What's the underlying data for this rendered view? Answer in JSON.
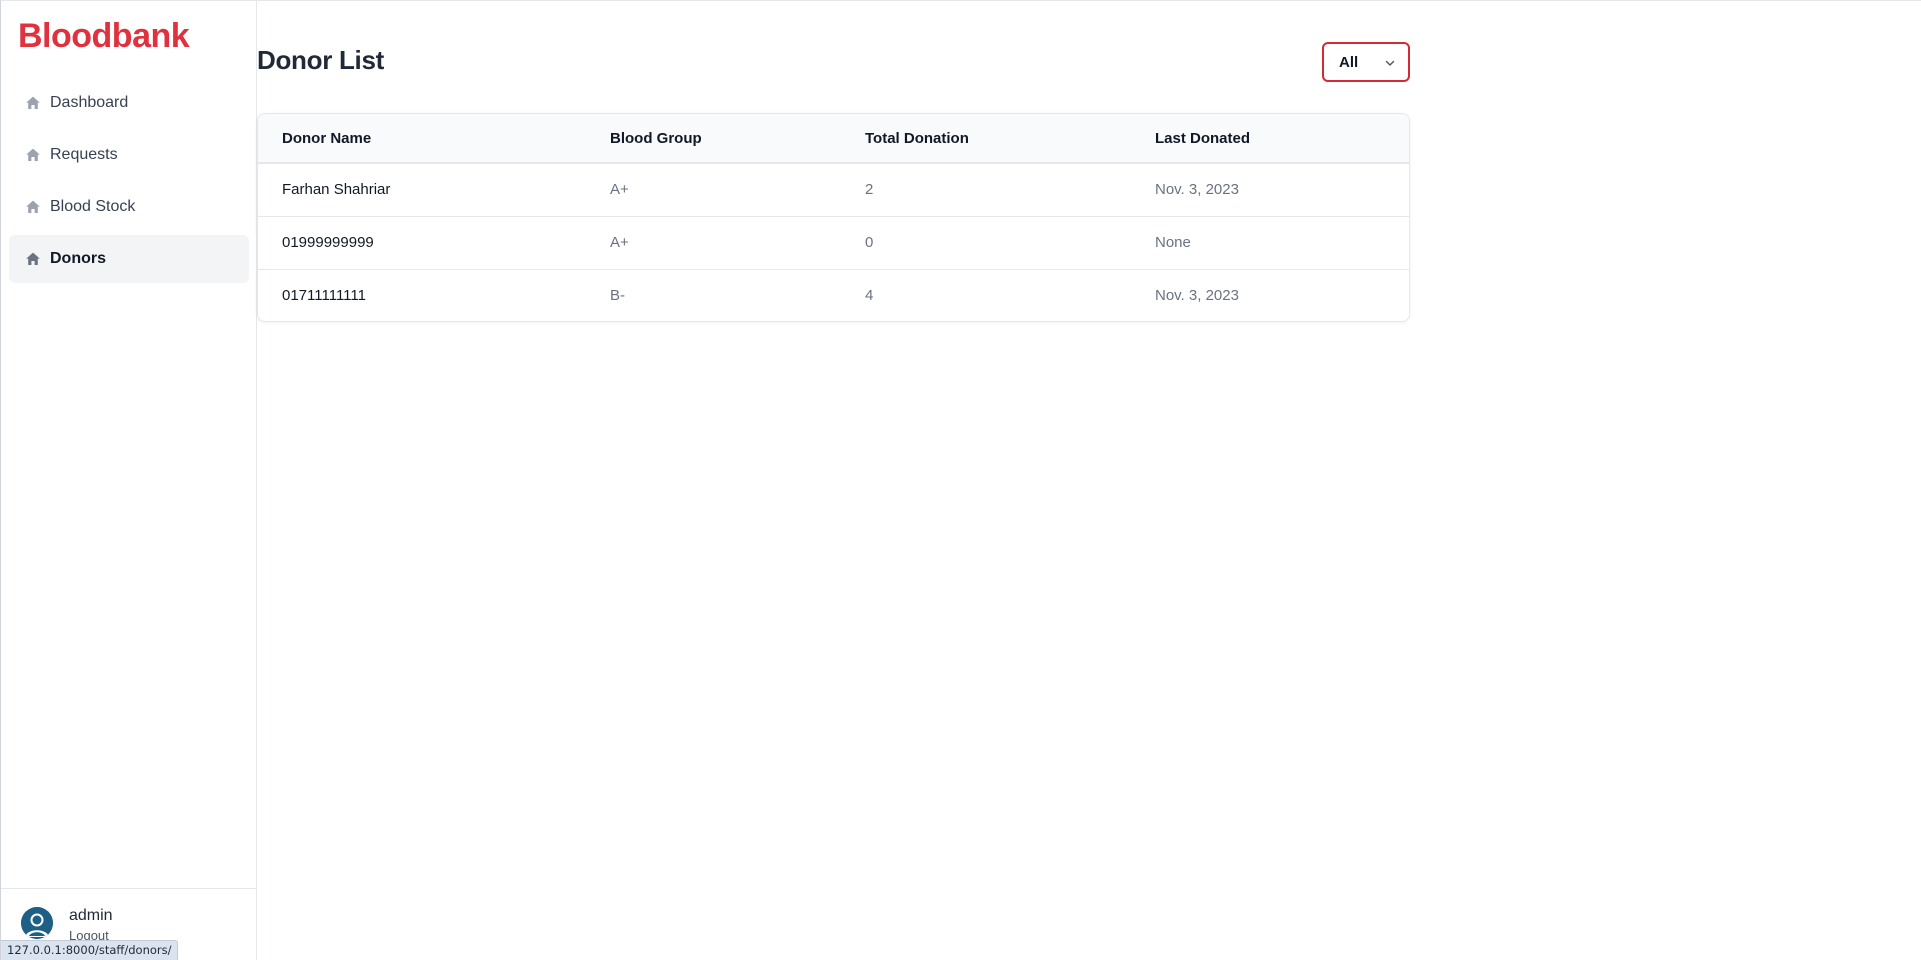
{
  "sidebar": {
    "brand": "Bloodbank",
    "items": [
      {
        "label": "Dashboard",
        "icon": "home-icon",
        "active": false
      },
      {
        "label": "Requests",
        "icon": "home-icon",
        "active": false
      },
      {
        "label": "Blood Stock",
        "icon": "home-icon",
        "active": false
      },
      {
        "label": "Donors",
        "icon": "home-icon",
        "active": true
      }
    ],
    "user": {
      "name": "admin",
      "logout_label": "Logout"
    }
  },
  "status_bar": {
    "url": "127.0.0.1:8000/staff/donors/"
  },
  "main": {
    "title": "Donor List",
    "filter": {
      "selected": "All"
    },
    "table": {
      "headers": [
        "Donor Name",
        "Blood Group",
        "Total Donation",
        "Last Donated"
      ],
      "rows": [
        [
          "Farhan Shahriar",
          "A+",
          "2",
          "Nov. 3, 2023"
        ],
        [
          "01999999999",
          "A+",
          "0",
          "None"
        ],
        [
          "01711111111",
          "B-",
          "4",
          "Nov. 3, 2023"
        ]
      ]
    }
  },
  "colors": {
    "brand": "#e0313f",
    "filter_border": "#d32a38",
    "avatar": "#1e5f86"
  }
}
